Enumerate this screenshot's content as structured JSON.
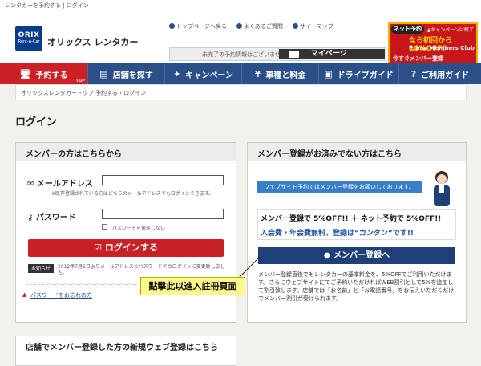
{
  "browser": {
    "title": "レンタカーを予約する | ログイン"
  },
  "header": {
    "logo_text": "ORIX",
    "logo_sub": "Rent-A-Car",
    "brand": "オリックス レンタカー",
    "links": [
      "トップページへ戻る",
      "よくあるご質問",
      "サイトマップ"
    ],
    "reservation_message": "未完了の予約情報はございません",
    "mypage_label": "マイページ",
    "promo": {
      "badge": "ネット予約",
      "close_label": "▲キャンペーンは終了",
      "line1": "なら初回から10%OFF!",
      "line2": "Prime Members Club",
      "line3": "今すぐメンバー登録"
    }
  },
  "nav": {
    "items": [
      {
        "label": "予約する",
        "sub": "TOP",
        "icon": "monitor-icon"
      },
      {
        "label": "店舗を探す",
        "icon": "table-icon"
      },
      {
        "label": "キャンペーン",
        "icon": "megaphone-icon"
      },
      {
        "label": "車種と料金",
        "icon": "yen-icon"
      },
      {
        "label": "ドライブガイド",
        "icon": "car-icon"
      },
      {
        "label": "ご利用ガイド",
        "icon": "question-icon"
      }
    ]
  },
  "breadcrumb": {
    "home": "オリックスレンタカートップ",
    "reserve": "予約する",
    "current": "ログイン"
  },
  "page": {
    "title": "ログイン"
  },
  "login": {
    "heading": "メンバーの方はこちらから",
    "email_label": "メールアドレス",
    "email_value": "",
    "email_note": "※既存登録されている方はどちらのメールアドレスでもログインできます。",
    "password_label": "パスワード",
    "password_value": "",
    "remember_label": "パスワードを保存しない",
    "login_button": "ログインする",
    "notice_tag": "お知らせ",
    "notice_text": "2012年7月2日よりメールアドレスとパスワードでのログインに変更致しました。",
    "forgot_link": "パスワードをお忘れの方"
  },
  "register": {
    "heading": "メンバー登録がお済みでない方はこちら",
    "banner": "ウェブサイト予約ではメンバー登録をお願いしております。",
    "discount_line1": "メンバー登録で 5%OFF!! ＋ ネット予約で 5%OFF!!",
    "discount_line2": "入会費・年会費無料、登録は“カンタン”です!!",
    "button": "メンバー登録へ",
    "description": "メンバー登録直後でもレンタカーの基本料金を、5%OFFでご利用いただけます。さらにウェブサイトにてご予約いただければWEB割引として5%を追加して割引致します。店舗では「お名前」と「お電話番号」をお伝えいただくだけでメンバー割引が受けられます。"
  },
  "callout": {
    "text": "點擊此以進入註冊頁面"
  },
  "store_register": {
    "heading": "店舗でメンバー登録した方の新規ウェブ登録はこちら"
  },
  "colors": {
    "nav": "#2b4f88",
    "accent": "#c72025",
    "member_button": "#1f3f78",
    "callout": "#fff88a"
  }
}
